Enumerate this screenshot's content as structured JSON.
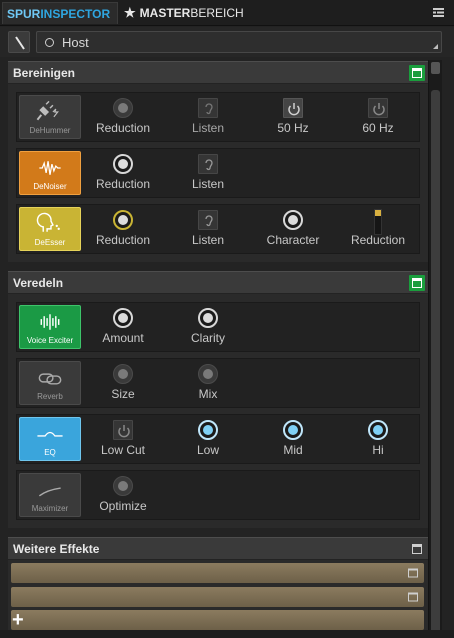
{
  "tabs": {
    "spur_a": "SPUR",
    "spur_b": "INSPECTOR",
    "master_a": "MASTER",
    "master_b": "BEREICH"
  },
  "host": {
    "value": "Host"
  },
  "sections": {
    "bereinigen": {
      "title": "Bereinigen"
    },
    "veredeln": {
      "title": "Veredeln"
    },
    "weitere": {
      "title": "Weitere Effekte"
    }
  },
  "dehummer": {
    "module": "DeHummer",
    "c1": "Reduction",
    "c2": "Listen",
    "c3": "50 Hz",
    "c4": "60 Hz"
  },
  "denoiser": {
    "module": "DeNoiser",
    "c1": "Reduction",
    "c2": "Listen"
  },
  "deesser": {
    "module": "DeEsser",
    "c1": "Reduction",
    "c2": "Listen",
    "c3": "Character",
    "c4": "Reduction"
  },
  "voice": {
    "module": "Voice Exciter",
    "c1": "Amount",
    "c2": "Clarity"
  },
  "reverb": {
    "module": "Reverb",
    "c1": "Size",
    "c2": "Mix"
  },
  "eq": {
    "module": "EQ",
    "c1": "Low Cut",
    "c2": "Low",
    "c3": "Mid",
    "c4": "Hi"
  },
  "maximizer": {
    "module": "Maximizer",
    "c1": "Optimize"
  },
  "add_label": "+",
  "colors": {
    "accent": "#2fa6e0",
    "green": "#1b9a45",
    "orange": "#d27a1a",
    "yellow": "#c9b434",
    "blue": "#3aa5dc"
  }
}
